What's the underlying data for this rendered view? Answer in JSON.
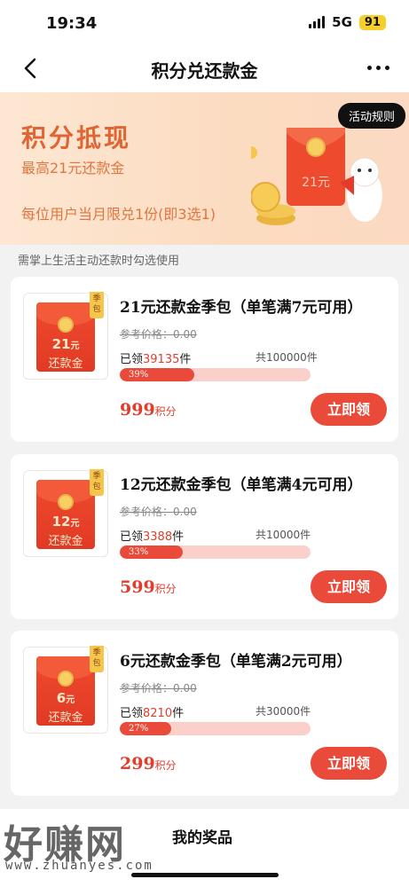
{
  "status_bar": {
    "time": "19:34",
    "network": "5G",
    "battery": "91"
  },
  "nav": {
    "title": "积分兑还款金"
  },
  "banner": {
    "title": "积分抵现",
    "subtitle": "最高21元还款金",
    "note": "每位用户当月限兑1份(即3选1)",
    "rules_button": "活动规则",
    "packet_amount": "21元"
  },
  "hint": "需掌上生活主动还款时勾选使用",
  "products": [
    {
      "tag": "季包",
      "packet_amount": "21",
      "packet_unit": "元",
      "packet_label": "还款金",
      "title": "21元还款金季包（单笔满7元可用）",
      "ref_price": "参考价格：0.00",
      "claimed_prefix": "已领",
      "claimed_count": "39135",
      "claimed_suffix": "件",
      "total": "共100000件",
      "progress_label": "39%",
      "progress": 39,
      "price": "999",
      "price_unit": "积分",
      "button": "立即领"
    },
    {
      "tag": "季包",
      "packet_amount": "12",
      "packet_unit": "元",
      "packet_label": "还款金",
      "title": "12元还款金季包（单笔满4元可用）",
      "ref_price": "参考价格：0.00",
      "claimed_prefix": "已领",
      "claimed_count": "3388",
      "claimed_suffix": "件",
      "total": "共10000件",
      "progress_label": "33%",
      "progress": 33,
      "price": "599",
      "price_unit": "积分",
      "button": "立即领"
    },
    {
      "tag": "季包",
      "packet_amount": "6",
      "packet_unit": "元",
      "packet_label": "还款金",
      "title": "6元还款金季包（单笔满2元可用）",
      "ref_price": "参考价格：0.00",
      "claimed_prefix": "已领",
      "claimed_count": "8210",
      "claimed_suffix": "件",
      "total": "共30000件",
      "progress_label": "27%",
      "progress": 27,
      "price": "299",
      "price_unit": "积分",
      "button": "立即领"
    }
  ],
  "bottom": {
    "watermark": "好赚网",
    "watermark_url": "www.zhuanyes.com",
    "my_prizes": "我的奖品"
  },
  "colors": {
    "accent": "#ea4a3a",
    "banner_text": "#e06535"
  }
}
